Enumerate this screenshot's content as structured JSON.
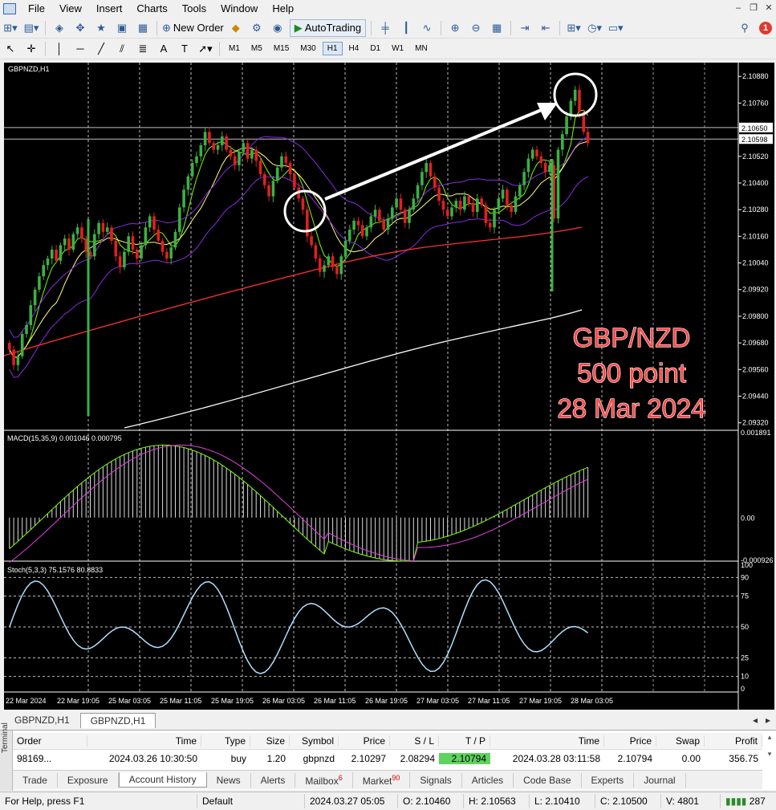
{
  "menu": [
    "File",
    "View",
    "Insert",
    "Charts",
    "Tools",
    "Window",
    "Help"
  ],
  "toolbar": {
    "new_order": "New Order",
    "autotrading": "AutoTrading",
    "notification_count": "1",
    "timeframes": [
      "M1",
      "M5",
      "M15",
      "M30",
      "H1",
      "H4",
      "D1",
      "W1",
      "MN"
    ],
    "active_timeframe": "H1"
  },
  "chart": {
    "symbol_label": "GBPNZD,H1",
    "macd_label": "MACD(15,35,9) 0.001046 0.000795",
    "stoch_label": "Stoch(5,3,3) 75.1576 80.8833",
    "overlay_lines": [
      "GBP/NZD",
      "500 point",
      "28 Mar 2024"
    ],
    "price_ticks": [
      "2.10880",
      "2.10760",
      "2.10650",
      "2.10598",
      "2.10520",
      "2.10400",
      "2.10280",
      "2.10160",
      "2.10040",
      "2.09920",
      "2.09800",
      "2.09680",
      "2.09560",
      "2.09440",
      "2.09320"
    ],
    "macd_ticks": [
      "0.001891",
      "0.00",
      "-0.000926"
    ],
    "stoch_ticks": [
      "100",
      "90",
      "75",
      "50",
      "25",
      "10",
      "0"
    ],
    "time_ticks": [
      "22 Mar 2024",
      "22 Mar 19:05",
      "25 Mar 03:05",
      "25 Mar 11:05",
      "25 Mar 19:05",
      "26 Mar 03:05",
      "26 Mar 11:05",
      "26 Mar 19:05",
      "27 Mar 03:05",
      "27 Mar 11:05",
      "27 Mar 19:05",
      "28 Mar 03:05"
    ],
    "colors": {
      "bull": "#3cb043",
      "bear": "#e02020",
      "overlay_text": "#ff4040"
    }
  },
  "chart_tabs": [
    "GBPNZD,H1",
    "GBPNZD,H1"
  ],
  "terminal": {
    "side_label": "Terminal",
    "headers": [
      "Order",
      "Time",
      "Type",
      "Size",
      "Symbol",
      "Price",
      "S / L",
      "T / P",
      "Time",
      "Price",
      "Swap",
      "Profit"
    ],
    "row": [
      "98169...",
      "2024.03.26 10:30:50",
      "buy",
      "1.20",
      "gbpnzd",
      "2.10297",
      "2.08294",
      "2.10794",
      "2024.03.28 03:11:58",
      "2.10794",
      "0.00",
      "356.75"
    ],
    "tabs": [
      {
        "label": "Trade",
        "badge": ""
      },
      {
        "label": "Exposure",
        "badge": ""
      },
      {
        "label": "Account History",
        "badge": ""
      },
      {
        "label": "News",
        "badge": ""
      },
      {
        "label": "Alerts",
        "badge": ""
      },
      {
        "label": "Mailbox",
        "badge": "6"
      },
      {
        "label": "Market",
        "badge": "90"
      },
      {
        "label": "Signals",
        "badge": ""
      },
      {
        "label": "Articles",
        "badge": ""
      },
      {
        "label": "Code Base",
        "badge": ""
      },
      {
        "label": "Experts",
        "badge": ""
      },
      {
        "label": "Journal",
        "badge": ""
      }
    ]
  },
  "status": {
    "help": "For Help, press F1",
    "profile": "Default",
    "datetime": "2024.03.27 05:05",
    "open": "O: 2.10460",
    "high": "H: 2.10563",
    "low": "L: 2.10410",
    "close": "C: 2.10500",
    "volume": "V: 4801",
    "traffic": "287"
  }
}
